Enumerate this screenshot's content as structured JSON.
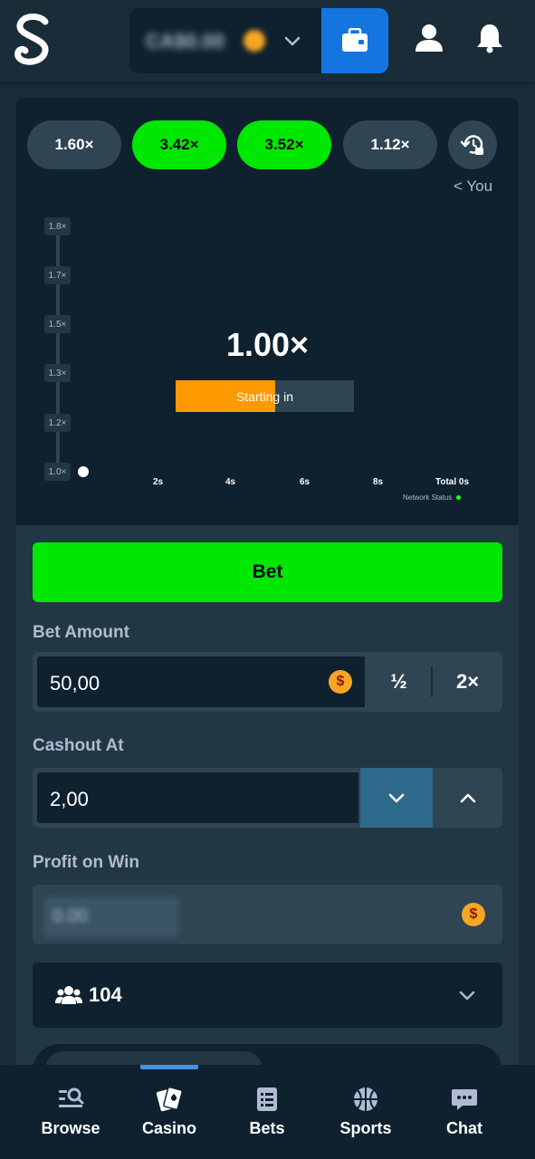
{
  "header": {
    "balance": "CA$0.00",
    "wallet_icon": "wallet-icon",
    "profile_icon": "user-icon",
    "notifications_icon": "bell-icon"
  },
  "history": [
    "1.60×",
    "3.42×",
    "3.52×",
    "1.12×"
  ],
  "history_colors": [
    "grey",
    "green",
    "green",
    "grey"
  ],
  "you_label": "< You",
  "graph": {
    "y_ticks": [
      "1.8×",
      "1.7×",
      "1.5×",
      "1.3×",
      "1.2×",
      "1.0×"
    ],
    "x_ticks": [
      "2s",
      "4s",
      "6s",
      "8s",
      "Total 0s"
    ],
    "network_status": "Network Status",
    "multiplier": "1.00×",
    "countdown_label": "Starting in",
    "countdown_progress": 0.56
  },
  "controls": {
    "bet_button": "Bet",
    "bet_amount_label": "Bet Amount",
    "bet_amount_value": "50,00",
    "half_label": "½",
    "double_label": "2×",
    "cashout_label": "Cashout At",
    "cashout_value": "2,00",
    "profit_label": "Profit on Win",
    "profit_value": "0.00",
    "currency_symbol": "$",
    "players_count": "104"
  },
  "nav": [
    {
      "label": "Browse",
      "icon": "browse-icon"
    },
    {
      "label": "Casino",
      "icon": "casino-cards-icon"
    },
    {
      "label": "Bets",
      "icon": "bets-list-icon"
    },
    {
      "label": "Sports",
      "icon": "basketball-icon"
    },
    {
      "label": "Chat",
      "icon": "chat-icon"
    }
  ],
  "colors": {
    "accent_green": "#00e701",
    "accent_blue": "#1475e1",
    "progress_orange": "#ff9900"
  }
}
